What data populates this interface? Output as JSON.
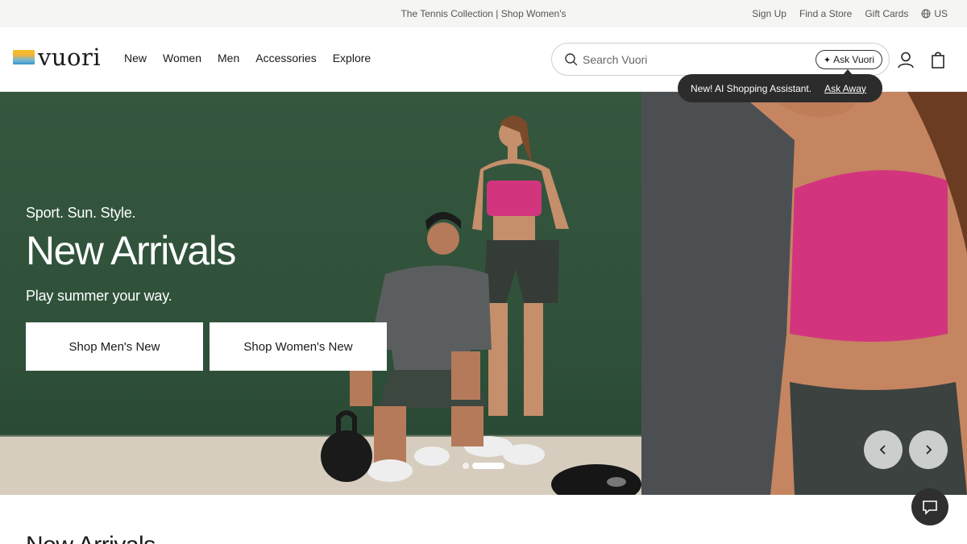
{
  "announcement": {
    "promo": "The Tennis Collection | Shop Women's",
    "links": [
      "Sign Up",
      "Find a Store",
      "Gift Cards"
    ],
    "locale": "US"
  },
  "header": {
    "logo_text": "vuori",
    "nav": [
      "New",
      "Women",
      "Men",
      "Accessories",
      "Explore"
    ],
    "search_placeholder": "Search Vuori",
    "ask_label": "Ask Vuori"
  },
  "tooltip": {
    "text": "New! AI Shopping Assistant.",
    "link": "Ask Away"
  },
  "hero": {
    "eyebrow": "Sport. Sun. Style.",
    "title": "New Arrivals",
    "subtitle": "Play summer your way.",
    "buttons": [
      "Shop Men's New",
      "Shop Women's New"
    ],
    "slide_count": 2,
    "active_slide": 2
  },
  "section": {
    "heading_peek": "New Arrivals"
  },
  "colors": {
    "hero_green": "#35573e",
    "tooltip_bg": "#2c2c2c",
    "top_bar_bg": "#f5f5f4",
    "bra_pink": "#d2357e"
  },
  "icons": [
    "search-icon",
    "sparkle-icon",
    "account-icon",
    "bag-icon",
    "globe-icon",
    "chevron-left-icon",
    "chevron-right-icon",
    "chat-icon"
  ]
}
